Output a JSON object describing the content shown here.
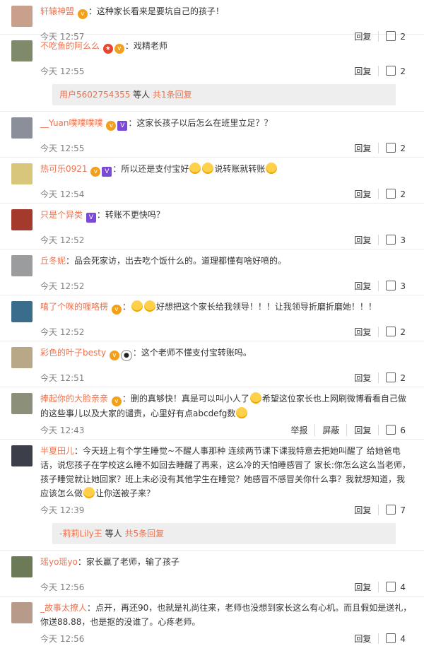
{
  "comments": [
    {
      "user": "轩辕神盟",
      "text": "：这种家长看来是要坑自己的孩子！",
      "time": "今天 12:57",
      "actions": [
        "回复"
      ],
      "likes": "2",
      "avatar_color": "#c9a08c",
      "badges": [
        "v"
      ],
      "emojis_after": []
    },
    {
      "user": "不吃鱼的阿么么",
      "text": "：戏精老师",
      "time": "今天 12:55",
      "actions": [
        "回复"
      ],
      "likes": "2",
      "avatar_color": "#7e8a6a",
      "badges": [
        "star",
        "v"
      ],
      "emojis_after": []
    },
    {
      "user": "__Yuan噗噗噗噗",
      "text": "：这家长孩子以后怎么在班里立足？？",
      "time": "今天 12:55",
      "actions": [
        "回复"
      ],
      "likes": "2",
      "avatar_color": "#8a8f99",
      "badges": [
        "v",
        "vip"
      ],
      "emojis_after": []
    },
    {
      "user": "热可乐0921",
      "text": "：所以还是支付宝好",
      "text2": "说转账就转账",
      "time": "今天 12:54",
      "actions": [
        "回复"
      ],
      "likes": "2",
      "avatar_color": "#d8c77a",
      "badges": [
        "v",
        "vip"
      ],
      "emojis_after": []
    },
    {
      "user": "只是个异类",
      "text": "：转账不更快吗？",
      "time": "今天 12:52",
      "actions": [
        "回复"
      ],
      "likes": "3",
      "avatar_color": "#a33a2c",
      "badges": [
        "vip"
      ],
      "emojis_after": []
    },
    {
      "user": "丘冬妮",
      "text": "：品会死家访，出去吃个饭什么的。道理都懂有啥好喷的。",
      "time": "今天 12:52",
      "actions": [
        "回复"
      ],
      "likes": "3",
      "avatar_color": "#9a9c9e",
      "badges": [],
      "emojis_after": []
    },
    {
      "user": "嘻了个咪的喱咯楞",
      "text": "：",
      "text2": "好想把这个家长给我领导！！！让我领导折磨折磨她！！！",
      "time": "今天 12:52",
      "actions": [
        "回复"
      ],
      "likes": "2",
      "avatar_color": "#3a6c8c",
      "badges": [
        "v"
      ],
      "emojis_after": []
    },
    {
      "user": "彩色的叶子besty",
      "text": "：这个老师不懂支付宝转账吗。",
      "time": "今天 12:51",
      "actions": [
        "回复"
      ],
      "likes": "2",
      "avatar_color": "#b8a888",
      "badges": [
        "v",
        "panda"
      ],
      "emojis_after": []
    },
    {
      "user": "捧起你的大脸亲亲",
      "text": "：删的真够快！真是可以叫小人了",
      "text2": "希望这位家长也上网刷微博看看自己做的这些事儿以及大家的谴责，心里好有点abcdefg数",
      "time": "今天 12:43",
      "actions": [
        "举报",
        "屏蔽",
        "回复"
      ],
      "likes": "6",
      "avatar_color": "#8c8f7a",
      "badges": [
        "v"
      ],
      "emojis_after": []
    },
    {
      "user": "半夏田儿",
      "text": "：今天班上有个学生睡觉~不醒人事那种 连续两节课下课我特意去把她叫醒了 给她爸电话，说您孩子在学校这么睡不如回去睡醒了再来，这么冷的天怕睡感冒了 家长:你怎么这么当老师，孩子睡觉就让她回家？班上未必没有其他学生在睡觉？她感冒不感冒关你什么事？我就想知道，我应该怎么做",
      "text2": "让你送被子来？",
      "time": "今天 12:39",
      "actions": [
        "回复"
      ],
      "likes": "7",
      "avatar_color": "#3c3f4a",
      "badges": [],
      "emojis_after": []
    },
    {
      "user": "瑶yo瑶yo",
      "text": "：家长赢了老师，输了孩子",
      "time": "今天 12:56",
      "actions": [
        "回复"
      ],
      "likes": "4",
      "avatar_color": "#6d7a58",
      "badges": [],
      "emojis_after": []
    },
    {
      "user": "_故事太撩人",
      "text": "：点开，再还90，也就是礼尚往来，老师也没想到家长这么有心机。而且假如是送礼，你送88.88，也是抠的没谁了。心疼老师。",
      "time": "今天 12:56",
      "actions": [
        "回复"
      ],
      "likes": "4",
      "avatar_color": "#b89a8a",
      "badges": [],
      "emojis_after": []
    }
  ],
  "reply_boxes": [
    {
      "user": "用户5602754355",
      "mid": " 等人 ",
      "count": "共1条回复"
    },
    {
      "user": "-莉莉Lily王",
      "mid": " 等人 ",
      "count": "共5条回复"
    }
  ]
}
